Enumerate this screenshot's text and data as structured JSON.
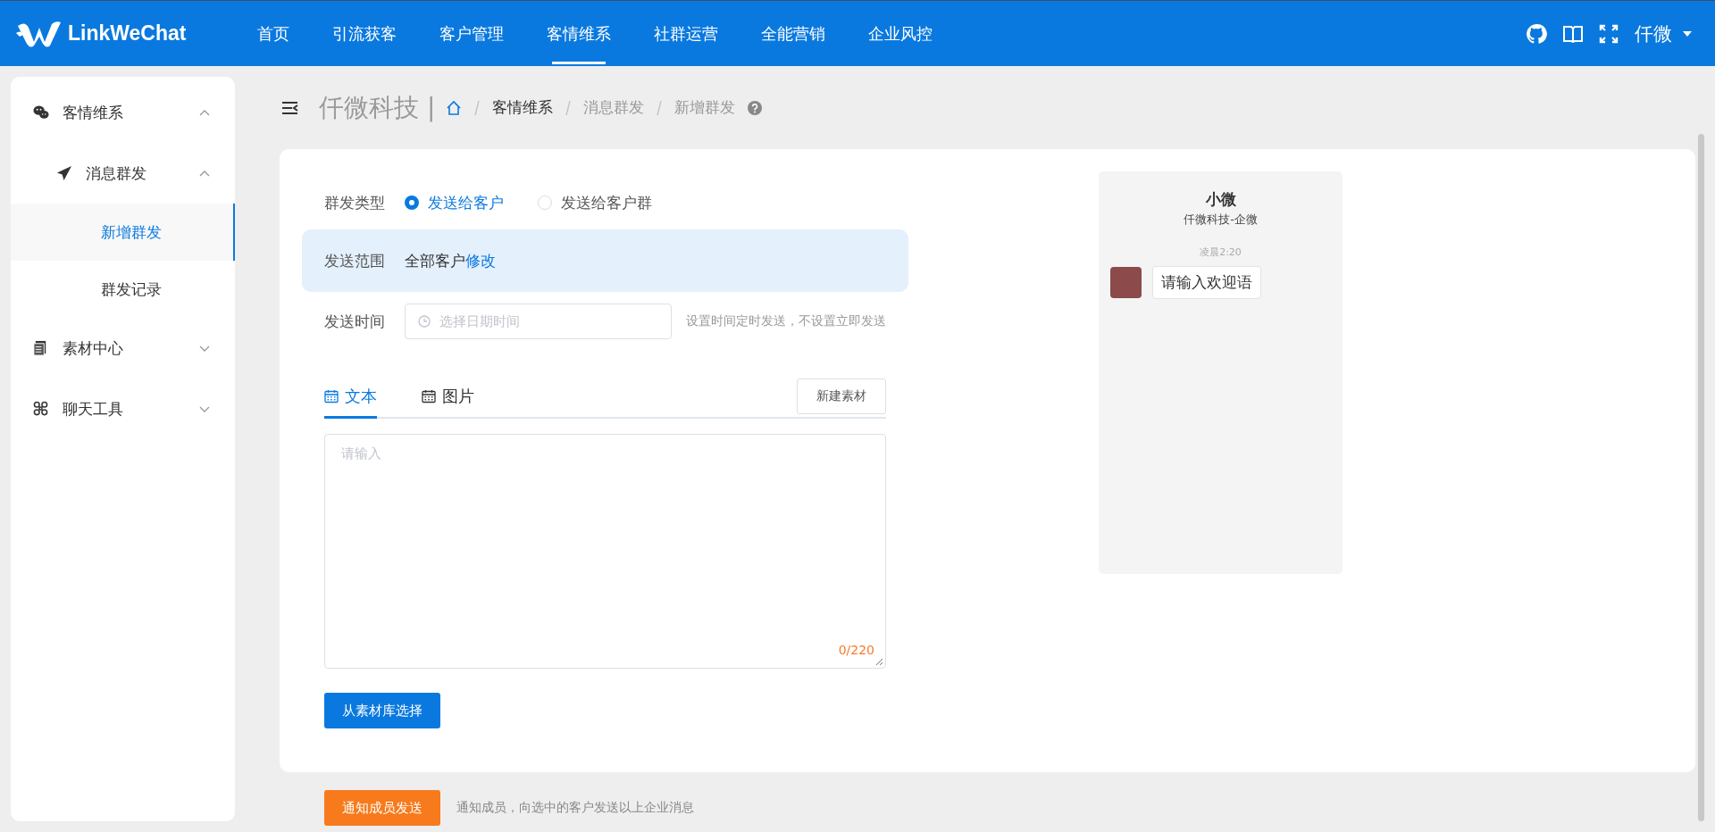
{
  "header": {
    "logo": "LinkWeChat",
    "nav": [
      {
        "label": "首页",
        "selected": false
      },
      {
        "label": "引流获客",
        "selected": false
      },
      {
        "label": "客户管理",
        "selected": false
      },
      {
        "label": "客情维系",
        "selected": true
      },
      {
        "label": "社群运营",
        "selected": false
      },
      {
        "label": "全能营销",
        "selected": false
      },
      {
        "label": "企业风控",
        "selected": false
      }
    ],
    "user": "仟微"
  },
  "sidebar": {
    "items": [
      {
        "label": "客情维系",
        "expanded": true,
        "children": [
          {
            "label": "消息群发",
            "expanded": true,
            "children": [
              {
                "label": "新增群发",
                "selected": true
              },
              {
                "label": "群发记录",
                "selected": false
              }
            ]
          }
        ]
      },
      {
        "label": "素材中心",
        "expanded": false
      },
      {
        "label": "聊天工具",
        "expanded": false
      }
    ]
  },
  "breadcrumb": {
    "company": "仟微科技 |",
    "items": [
      "客情维系",
      "消息群发",
      "新增群发"
    ]
  },
  "form": {
    "type_label": "群发类型",
    "type_options": [
      {
        "label": "发送给客户",
        "selected": true
      },
      {
        "label": "发送给客户群",
        "selected": false
      }
    ],
    "range_label": "发送范围",
    "range_value": "全部客户",
    "range_link": "修改",
    "time_label": "发送时间",
    "time_placeholder": "选择日期时间",
    "time_hint": "设置时间定时发送，不设置立即发送",
    "tabs": [
      {
        "label": "文本",
        "selected": true
      },
      {
        "label": "图片",
        "selected": false
      }
    ],
    "new_button": "新建素材",
    "text_placeholder": "请输入",
    "counter": "0/220",
    "library_button": "从素材库选择"
  },
  "preview": {
    "name": "小微",
    "company": "仟微科技-企微",
    "time": "凌晨2:20",
    "message": "请输入欢迎语"
  },
  "footer": {
    "button": "通知成员发送",
    "hint": "通知成员，向选中的客户发送以上企业消息"
  }
}
